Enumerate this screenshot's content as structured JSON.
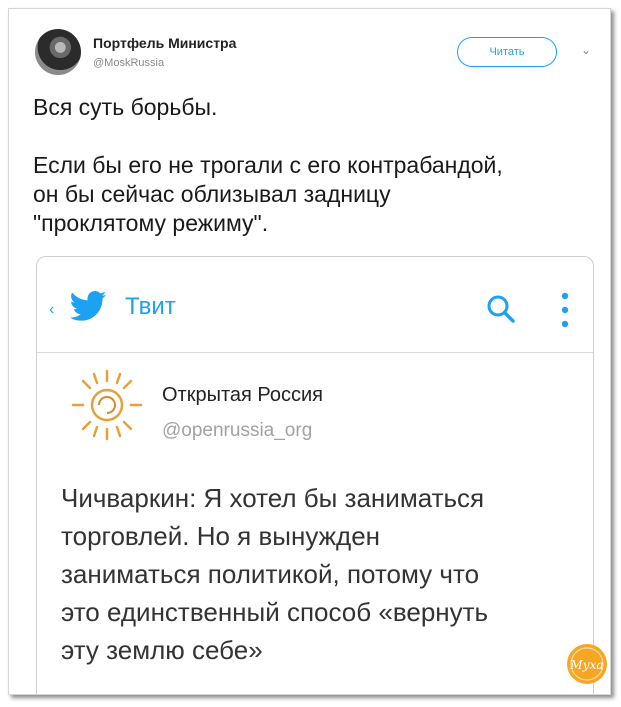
{
  "tweet": {
    "author_name": "Портфель Министра",
    "author_handle": "@MoskRussia",
    "follow_label": "Читать",
    "text_lines": [
      "Вся суть борьбы.",
      "",
      "Если бы его не трогали с его контрабандой,",
      "он бы сейчас облизывал задницу",
      "\"проклятому режиму\"."
    ]
  },
  "embedded_screenshot": {
    "header_title": "Твит",
    "org_name": "Открытая Россия",
    "org_handle": "@openrussia_org",
    "text_lines": [
      "Чичваркин: Я хотел бы заниматься",
      "торговлей. Но я вынужден",
      "заниматься политикой, потому что",
      "это единственный способ «вернуть",
      "эту землю себе»"
    ]
  },
  "icons": {
    "avatar": "avatar",
    "more": "chevron-down-icon",
    "back": "back-arrow-icon",
    "bird": "twitter-bird-icon",
    "search": "search-icon",
    "menu": "more-vertical-icon",
    "org_logo": "sun-logo",
    "watermark": "watermark-logo"
  },
  "colors": {
    "twitter_blue": "#1da1f2",
    "text": "#1a1a1a",
    "handle_gray": "#a2a2a2",
    "watermark_orange": "#f5a623"
  },
  "watermark_text": "Муха"
}
